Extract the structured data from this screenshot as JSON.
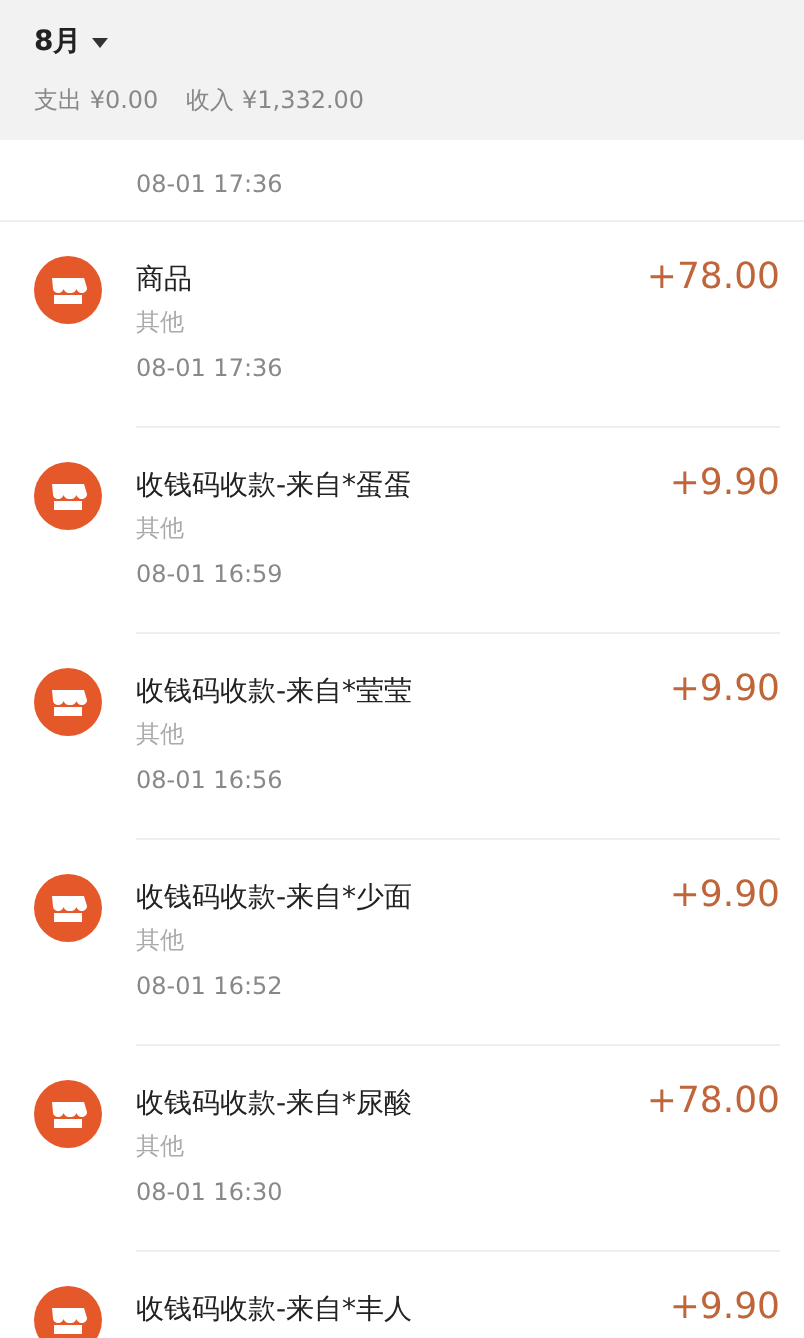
{
  "header": {
    "month": "8月",
    "summary": [
      {
        "label": "支出",
        "amount": "¥0.00"
      },
      {
        "label": "收入",
        "amount": "¥1,332.00"
      }
    ]
  },
  "partial_top": {
    "time": "08-01 17:36"
  },
  "transactions": [
    {
      "title": "商品",
      "category": "其他",
      "time": "08-01 17:36",
      "amount": "+78.00"
    },
    {
      "title": "收钱码收款-来自*蛋蛋",
      "category": "其他",
      "time": "08-01 16:59",
      "amount": "+9.90"
    },
    {
      "title": "收钱码收款-来自*莹莹",
      "category": "其他",
      "time": "08-01 16:56",
      "amount": "+9.90"
    },
    {
      "title": "收钱码收款-来自*少面",
      "category": "其他",
      "time": "08-01 16:52",
      "amount": "+9.90"
    },
    {
      "title": "收钱码收款-来自*尿酸",
      "category": "其他",
      "time": "08-01 16:30",
      "amount": "+78.00"
    },
    {
      "title": "收钱码收款-来自*丰人",
      "amount": "+9.90"
    }
  ]
}
